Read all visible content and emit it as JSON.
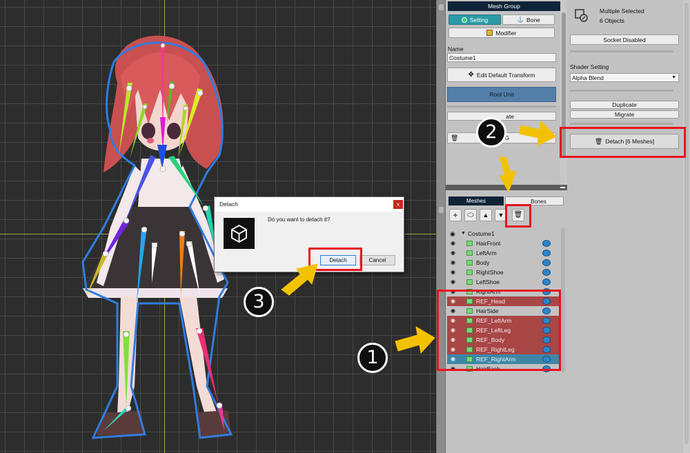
{
  "mesh_group_panel": {
    "header": "Mesh Group",
    "tab_setting": "Setting",
    "tab_bone": "Bone",
    "modifier_button": "Modifier",
    "name_label": "Name",
    "name_value": "Costume1",
    "edit_default_transform_button": "Edit Default Transform",
    "root_unit_label": "Root Unit",
    "duplicate_button_partial": "ate",
    "button_partial_2": "h G"
  },
  "list_panel": {
    "tab_meshes": "Meshes",
    "tab_bones": "Bones",
    "toolbar": {
      "add": "+",
      "link": "⬭",
      "up": "▲",
      "down": "▼",
      "delete": "🗑"
    },
    "root_item": "Costume1",
    "items": [
      {
        "name": "HairFront",
        "state": "normal"
      },
      {
        "name": "LeftArm",
        "state": "normal"
      },
      {
        "name": "Body",
        "state": "normal"
      },
      {
        "name": "RightShoe",
        "state": "normal"
      },
      {
        "name": "LeftShoe",
        "state": "normal"
      },
      {
        "name": "RightArm",
        "state": "normal"
      },
      {
        "name": "REF_Head",
        "state": "selected"
      },
      {
        "name": "HairSide",
        "state": "normal"
      },
      {
        "name": "REF_LeftArm",
        "state": "selected"
      },
      {
        "name": "REF_LeftLeg",
        "state": "selected"
      },
      {
        "name": "REF_Body",
        "state": "selected"
      },
      {
        "name": "REF_RightLeg",
        "state": "selected"
      },
      {
        "name": "REF_RightArm",
        "state": "active"
      },
      {
        "name": "HairBack",
        "state": "normal"
      }
    ]
  },
  "inspector": {
    "title": "Multiple Selected",
    "subtitle": "6 Objects",
    "socket_button": "Socket Disabled",
    "shader_label": "Shader Setting",
    "shader_value": "Alpha Blend",
    "duplicate_button": "Duplicate",
    "migrate_button": "Migrate",
    "detach_button": "Detach [6 Meshes]"
  },
  "dialog": {
    "title": "Detach",
    "close": "x",
    "message": "Do you want to detach it?",
    "detach_button": "Detach",
    "cancel_button": "Cancel"
  },
  "annotations": {
    "step1": "1",
    "step2": "2",
    "step3": "3"
  },
  "colors": {
    "highlight_red": "#e8131d",
    "selected_row": "#a84646",
    "active_row": "#3d87a6",
    "arrow_yellow": "#f2c200",
    "tab_active": "#2c9aa6"
  }
}
